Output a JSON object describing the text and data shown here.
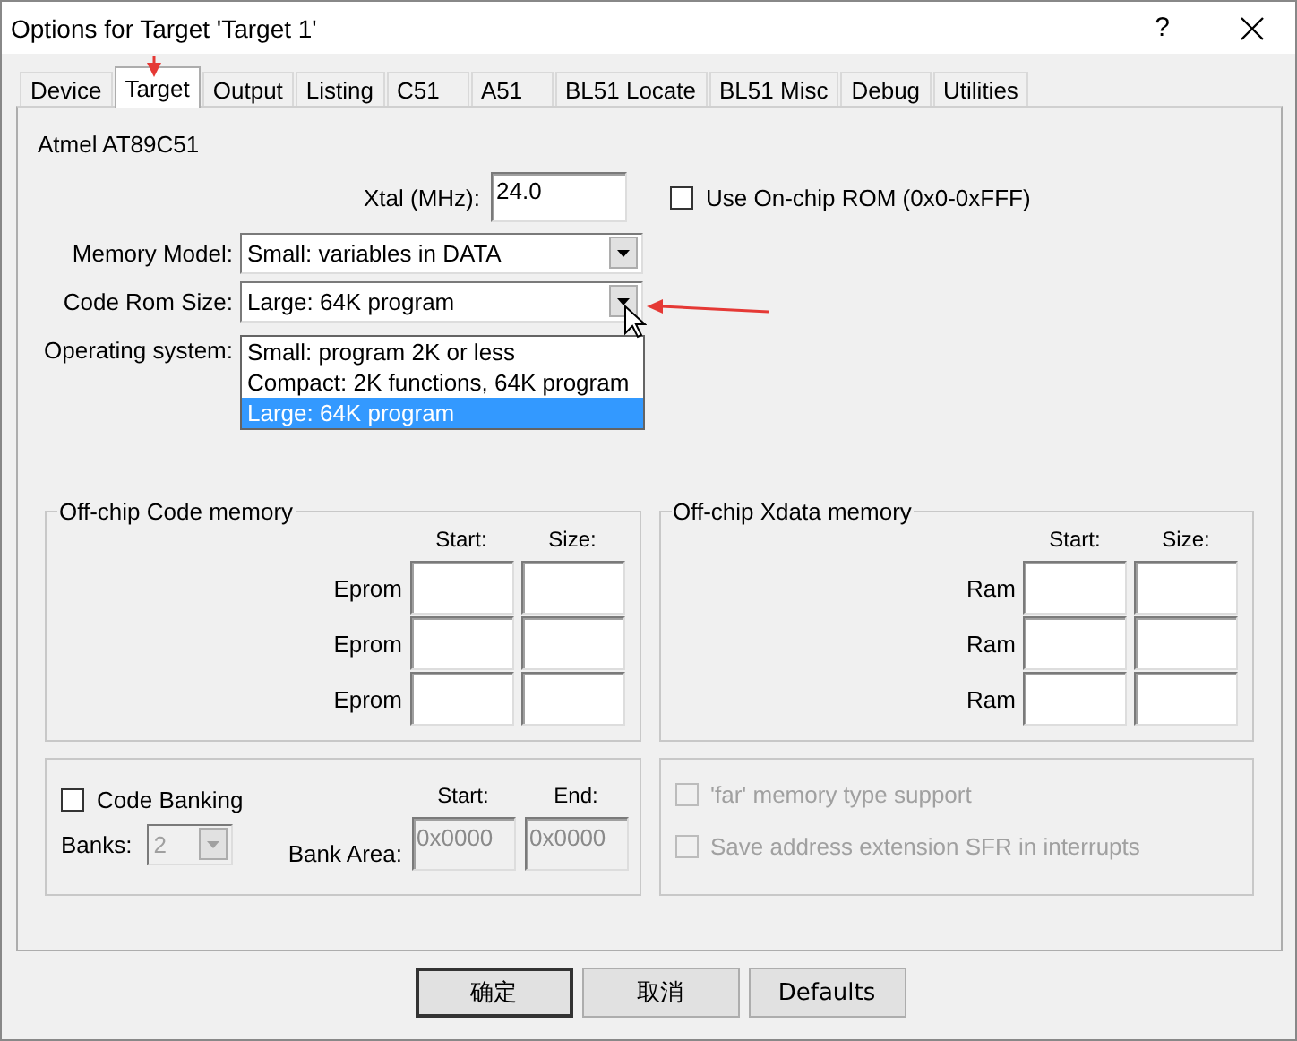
{
  "window": {
    "title": "Options for Target 'Target 1'",
    "help": "?"
  },
  "tabs": [
    {
      "label": "Device",
      "selected": false
    },
    {
      "label": "Target",
      "selected": true
    },
    {
      "label": "Output",
      "selected": false
    },
    {
      "label": "Listing",
      "selected": false
    },
    {
      "label": "C51",
      "selected": false
    },
    {
      "label": "A51",
      "selected": false
    },
    {
      "label": "BL51 Locate",
      "selected": false
    },
    {
      "label": "BL51 Misc",
      "selected": false
    },
    {
      "label": "Debug",
      "selected": false
    },
    {
      "label": "Utilities",
      "selected": false
    }
  ],
  "device": "Atmel AT89C51",
  "xtal": {
    "label": "Xtal (MHz):",
    "value": "24.0"
  },
  "onchip_rom": {
    "label": "Use On-chip ROM (0x0-0xFFF)",
    "checked": false
  },
  "memory_model": {
    "label": "Memory Model:",
    "value": "Small: variables in DATA"
  },
  "code_rom_size": {
    "label": "Code Rom Size:",
    "value": "Large: 64K program",
    "expanded": true,
    "options": [
      {
        "label": "Small: program 2K or less",
        "selected": false
      },
      {
        "label": "Compact: 2K functions, 64K program",
        "selected": false
      },
      {
        "label": "Large: 64K program",
        "selected": true
      }
    ]
  },
  "operating_system": {
    "label": "Operating system:"
  },
  "code_memory": {
    "title": "Off-chip Code memory",
    "columns": [
      "Start:",
      "Size:"
    ],
    "rows": [
      {
        "label": "Eprom"
      },
      {
        "label": "Eprom"
      },
      {
        "label": "Eprom"
      }
    ]
  },
  "xdata_memory": {
    "title": "Off-chip Xdata memory",
    "columns": [
      "Start:",
      "Size:"
    ],
    "rows": [
      {
        "label": "Ram"
      },
      {
        "label": "Ram"
      },
      {
        "label": "Ram"
      }
    ]
  },
  "code_banking": {
    "label": "Code Banking",
    "checked": false,
    "columns": [
      "Start:",
      "End:"
    ],
    "banks_label": "Banks:",
    "banks": "2",
    "area_label": "Bank Area:",
    "start": "0x0000",
    "end": "0x0000",
    "disabled": true
  },
  "options": [
    {
      "label": "'far' memory type support",
      "checked": false,
      "disabled": true
    },
    {
      "label": "Save address extension SFR in interrupts",
      "checked": false,
      "disabled": true
    }
  ],
  "buttons": [
    {
      "label": "确定",
      "default": true
    },
    {
      "label": "取消",
      "default": false
    },
    {
      "label": "Defaults",
      "default": false
    }
  ]
}
